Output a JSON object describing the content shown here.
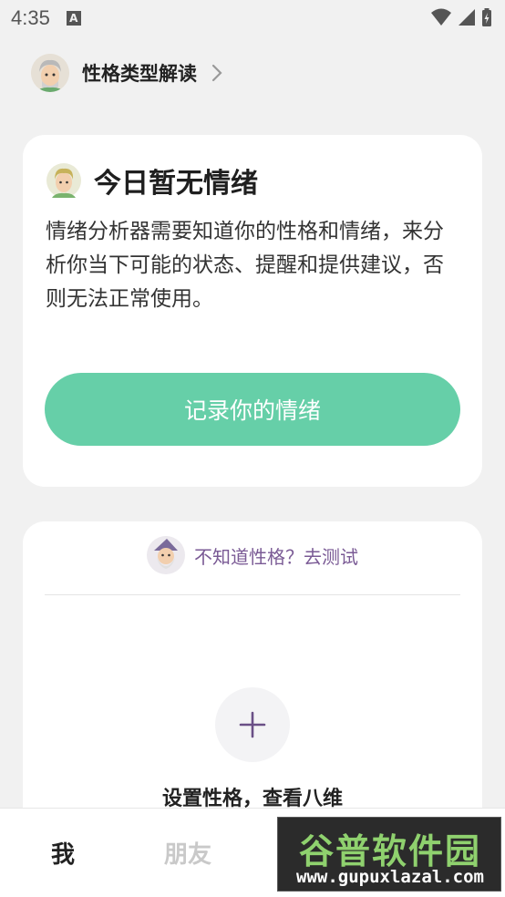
{
  "status_bar": {
    "time": "4:35",
    "icons": [
      "a-notification-icon",
      "wifi-icon",
      "signal-icon",
      "battery-charging-icon"
    ]
  },
  "header": {
    "title": "性格类型解读",
    "avatar_icon": "sage-avatar-icon",
    "chevron_icon": "chevron-right-icon"
  },
  "emotion_card": {
    "title": "今日暂无情绪",
    "avatar_icon": "blond-avatar-icon",
    "body": "情绪分析器需要知道你的性格和情绪，来分析你当下可能的状态、提醒和提供建议，否则无法正常使用。",
    "button_label": "记录你的情绪"
  },
  "personality_card": {
    "test_link": "不知道性格？去测试",
    "avatar_icon": "wizard-avatar-icon",
    "add_icon": "plus-icon",
    "set_label": "设置性格，查看八维"
  },
  "bottom_nav": {
    "tabs": [
      {
        "label": "我",
        "active": true
      },
      {
        "label": "朋友",
        "active": false
      }
    ]
  },
  "watermark": {
    "title": "谷普软件园",
    "url": "www.gupuxlazal.com"
  },
  "colors": {
    "accent_green": "#66cfa8",
    "link_purple": "#7a5a95",
    "background": "#f1f1f1"
  }
}
